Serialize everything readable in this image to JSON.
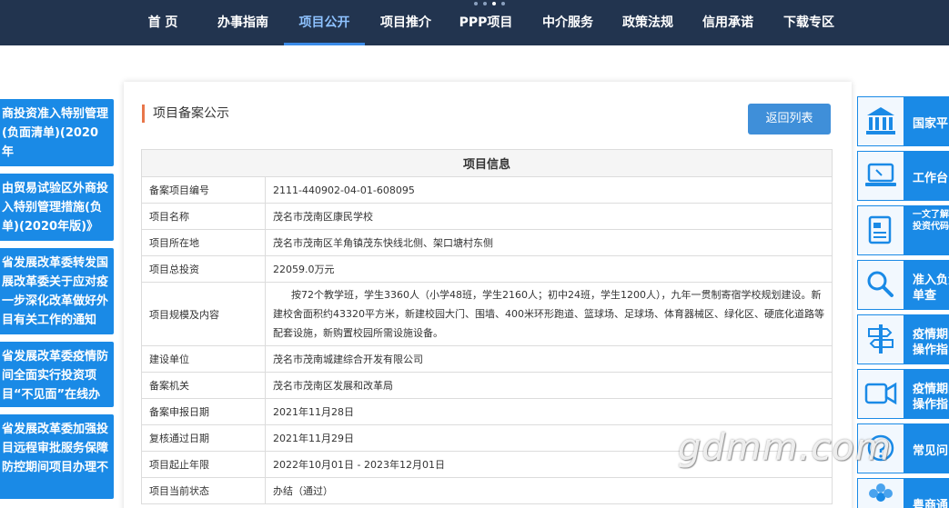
{
  "nav": {
    "items": [
      "首 页",
      "办事指南",
      "项目公开",
      "项目推介",
      "PPP项目",
      "中介服务",
      "政策法规",
      "信用承诺",
      "下载专区"
    ],
    "active_index": 2
  },
  "left_news": [
    "商投资准入特别管理(负面清单)(2020年",
    "由贸易试验区外商投入特别管理措施(负单)(2020年版)》",
    "省发展改革委转发国展改革委关于应对疫一步深化改革做好外目有关工作的通知",
    "省发展改革委疫情防间全面实行投资项目“不见面”在线办理",
    "省发展改革委加强投目远程审批服务保障防控期间项目办理不"
  ],
  "main": {
    "section_title": "项目备案公示",
    "back_button": "返回列表",
    "table_header": "项目信息",
    "rows": [
      {
        "key": "备案项目编号",
        "value": "2111-440902-04-01-608095"
      },
      {
        "key": "项目名称",
        "value": "茂名市茂南区康民学校"
      },
      {
        "key": "项目所在地",
        "value": "茂名市茂南区羊角镇茂东快线北侧、架口塘村东侧"
      },
      {
        "key": "项目总投资",
        "value": "22059.0万元"
      },
      {
        "key": "项目规模及内容",
        "value": "按72个教学班，学生3360人（小学48班，学生2160人；初中24班，学生1200人），九年一贯制寄宿学校规划建设。新建校舍面积约43320平方米，新建校园大门、围墙、400米环形跑道、篮球场、足球场、体育器械区、绿化区、硬底化道路等配套设施，新购置校园所需设施设备。"
      },
      {
        "key": "建设单位",
        "value": "茂名市茂南城建综合开发有限公司"
      },
      {
        "key": "备案机关",
        "value": "茂名市茂南区发展和改革局"
      },
      {
        "key": "备案申报日期",
        "value": "2021年11月28日"
      },
      {
        "key": "复核通过日期",
        "value": "2021年11月29日"
      },
      {
        "key": "项目起止年限",
        "value": "2022年10月01日 - 2023年12月01日"
      },
      {
        "key": "项目当前状态",
        "value": "办结（通过）"
      }
    ]
  },
  "right_links": [
    {
      "label": "国家平",
      "icon": "bank-icon"
    },
    {
      "label": "工作台",
      "icon": "monitor-icon"
    },
    {
      "label": "一文了解资产投资代码申领",
      "icon": "document-icon"
    },
    {
      "label": "准入负清单查",
      "icon": "magnifier-icon"
    },
    {
      "label": "疫情期间操作指",
      "icon": "signpost-icon"
    },
    {
      "label": "疫情期间操作指引",
      "icon": "video-camera-icon"
    },
    {
      "label": "常见问",
      "icon": "question-icon"
    },
    {
      "label": "粤商通",
      "icon": "flower-logo-icon"
    }
  ],
  "watermark": "gdmm.com",
  "colors": {
    "nav_bg": "#22344f",
    "accent_blue": "#1a8ae6",
    "title_bar": "#e8764a",
    "button_blue": "#3f8fd9"
  }
}
